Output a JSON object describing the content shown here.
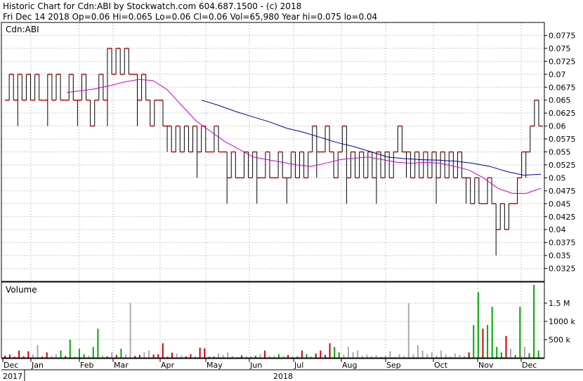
{
  "header": {
    "line1": "Historic Chart for Cdn:ABI by Stockwatch.com 604.687.1500 - (c) 2018",
    "line2": "Fri Dec 14 2018   Op=0.06   Hi=0.065   Lo=0.06   Cl=0.06   Vol=65,980   Year hi=0.075   lo=0.04"
  },
  "chart_data": {
    "type": "line",
    "symbol": "Cdn:ABI",
    "price_panel": {
      "label": "Cdn:ABI",
      "ylim": [
        0.03,
        0.08
      ],
      "yticks": [
        "0.0775",
        "0.075",
        "0.0725",
        "0.07",
        "0.0675",
        "0.065",
        "0.0625",
        "0.06",
        "0.0575",
        "0.055",
        "0.0525",
        "0.05",
        "0.0475",
        "0.045",
        "0.0425",
        "0.04",
        "0.0375",
        "0.035",
        "0.0325"
      ],
      "grid": true,
      "price_series": [
        0.065,
        0.07,
        0.065,
        0.07,
        0.065,
        0.07,
        0.065,
        0.07,
        0.065,
        0.065,
        0.07,
        0.065,
        0.07,
        0.065,
        0.065,
        0.07,
        0.065,
        0.065,
        0.07,
        0.065,
        0.06,
        0.065,
        0.07,
        0.065,
        0.075,
        0.07,
        0.075,
        0.07,
        0.075,
        0.07,
        0.07,
        0.065,
        0.07,
        0.065,
        0.06,
        0.065,
        0.065,
        0.06,
        0.06,
        0.055,
        0.06,
        0.055,
        0.06,
        0.055,
        0.06,
        0.055,
        0.06,
        0.055,
        0.055,
        0.06,
        0.055,
        0.055,
        0.05,
        0.055,
        0.05,
        0.05,
        0.055,
        0.05,
        0.055,
        0.05,
        0.05,
        0.055,
        0.05,
        0.05,
        0.055,
        0.05,
        0.05,
        0.055,
        0.05,
        0.055,
        0.05,
        0.055,
        0.06,
        0.055,
        0.055,
        0.06,
        0.055,
        0.05,
        0.055,
        0.06,
        0.05,
        0.055,
        0.05,
        0.055,
        0.05,
        0.055,
        0.05,
        0.055,
        0.05,
        0.055,
        0.05,
        0.055,
        0.06,
        0.055,
        0.055,
        0.05,
        0.055,
        0.05,
        0.055,
        0.05,
        0.055,
        0.05,
        0.055,
        0.05,
        0.055,
        0.05,
        0.055,
        0.05,
        0.05,
        0.045,
        0.05,
        0.045,
        0.045,
        0.05,
        0.045,
        0.04,
        0.045,
        0.04,
        0.045,
        0.045,
        0.05,
        0.055,
        0.055,
        0.06,
        0.065,
        0.06
      ],
      "ma_short_series": [
        0.0665,
        0.0668,
        0.0672,
        0.0678,
        0.0685,
        0.069,
        0.0688,
        0.067,
        0.064,
        0.061,
        0.059,
        0.057,
        0.0555,
        0.054,
        0.0535,
        0.053,
        0.0525,
        0.0522,
        0.0528,
        0.0535,
        0.0538,
        0.054,
        0.0535,
        0.053,
        0.0528,
        0.053,
        0.0528,
        0.0522,
        0.0515,
        0.05,
        0.048,
        0.047,
        0.047,
        0.048
      ],
      "ma_long_series": [
        0.065,
        0.064,
        0.0628,
        0.0618,
        0.0608,
        0.0596,
        0.0588,
        0.0578,
        0.0568,
        0.056,
        0.055,
        0.054,
        0.0537,
        0.0535,
        0.0534,
        0.0532,
        0.0528,
        0.0522,
        0.0512,
        0.0505,
        0.0507
      ],
      "colors": {
        "bars": "#000000",
        "close_tick": "#cc0000",
        "ma_short": "#cc00cc",
        "ma_long": "#000099"
      }
    },
    "volume_panel": {
      "label": "Volume",
      "ylim": [
        0,
        2000000
      ],
      "yticks": [
        "1.5 M",
        "1000 k",
        "500 k"
      ],
      "volumes": [
        60,
        90,
        30,
        200,
        40,
        180,
        90,
        350,
        30,
        150,
        50,
        100,
        200,
        50,
        500,
        40,
        250,
        100,
        60,
        300,
        800,
        70,
        40,
        150,
        80,
        250,
        100,
        1500,
        50,
        80,
        150,
        200,
        90,
        100,
        400,
        30,
        140,
        120,
        70,
        40,
        100,
        50,
        280,
        260,
        30,
        40,
        120,
        80,
        150,
        50,
        20,
        70,
        40,
        40,
        60,
        100,
        200,
        50,
        60,
        100,
        50,
        80,
        40,
        40,
        200,
        100,
        40,
        120,
        200,
        80,
        400,
        300,
        150,
        90,
        300,
        150,
        200,
        60,
        90,
        40,
        70,
        30,
        60,
        180,
        30,
        100,
        50,
        1500,
        100,
        350,
        200,
        100,
        150,
        60,
        200,
        90,
        40,
        120,
        80,
        60,
        150,
        900,
        1800,
        800,
        900,
        1400,
        300,
        150,
        600,
        250,
        80,
        1400,
        300,
        130,
        2000,
        200
      ],
      "volume_colors": [
        "#cc0000",
        "#cc0000",
        "#cc0000",
        "#cc0000",
        "#cc0000",
        "#cc0000",
        "#aaaaaa",
        "#aaaaaa",
        "#cc0000",
        "#cc0000",
        "#aaaaaa",
        "#aaaaaa",
        "#00aa00",
        "#cc0000",
        "#00aa00",
        "#aaaaaa",
        "#00aa00",
        "#00aa00",
        "#aaaaaa",
        "#00aa00",
        "#00aa00",
        "#aaaaaa",
        "#cc0000",
        "#aaaaaa",
        "#cc0000",
        "#00aa00",
        "#aaaaaa",
        "#aaaaaa",
        "#cc0000",
        "#cc0000",
        "#aaaaaa",
        "#aaaaaa",
        "#cc0000",
        "#cc0000",
        "#cc0000",
        "#cc0000",
        "#cc0000",
        "#aaaaaa",
        "#aaaaaa",
        "#cc0000",
        "#cc0000",
        "#aaaaaa",
        "#cc0000",
        "#cc0000",
        "#cc0000",
        "#00aa00",
        "#aaaaaa",
        "#aaaaaa",
        "#aaaaaa",
        "#aaaaaa",
        "#aaaaaa",
        "#cc0000",
        "#aaaaaa",
        "#aaaaaa",
        "#00aa00",
        "#aaaaaa",
        "#cc0000",
        "#aaaaaa",
        "#aaaaaa",
        "#00aa00",
        "#aaaaaa",
        "#cc0000",
        "#aaaaaa",
        "#00aa00",
        "#cc0000",
        "#00aa00",
        "#aaaaaa",
        "#cc0000",
        "#cc0000",
        "#cc0000",
        "#cc0000",
        "#00aa00",
        "#00aa00",
        "#aaaaaa",
        "#aaaaaa",
        "#aaaaaa",
        "#aaaaaa",
        "#aaaaaa",
        "#aaaaaa",
        "#aaaaaa",
        "#aaaaaa",
        "#aaaaaa",
        "#aaaaaa",
        "#aaaaaa",
        "#aaaaaa",
        "#aaaaaa",
        "#aaaaaa",
        "#aaaaaa",
        "#aaaaaa",
        "#aaaaaa",
        "#aaaaaa",
        "#aaaaaa",
        "#aaaaaa",
        "#aaaaaa",
        "#aaaaaa",
        "#aaaaaa",
        "#aaaaaa",
        "#aaaaaa",
        "#aaaaaa",
        "#aaaaaa",
        "#cc0000",
        "#00aa00",
        "#00aa00",
        "#cc0000",
        "#00aa00",
        "#00aa00",
        "#00aa00",
        "#00aa00",
        "#cc0000",
        "#aaaaaa",
        "#00aa00",
        "#00aa00",
        "#aaaaaa",
        "#00aa00",
        "#00aa00",
        "#00aa00"
      ]
    },
    "x_axis": {
      "months": [
        "Dec",
        "Jan",
        "Feb",
        "Mar",
        "Apr",
        "May",
        "Jun",
        "Jul",
        "Aug",
        "Sep",
        "Oct",
        "Nov",
        "Dec"
      ],
      "years": [
        "2017",
        "2018"
      ]
    }
  }
}
